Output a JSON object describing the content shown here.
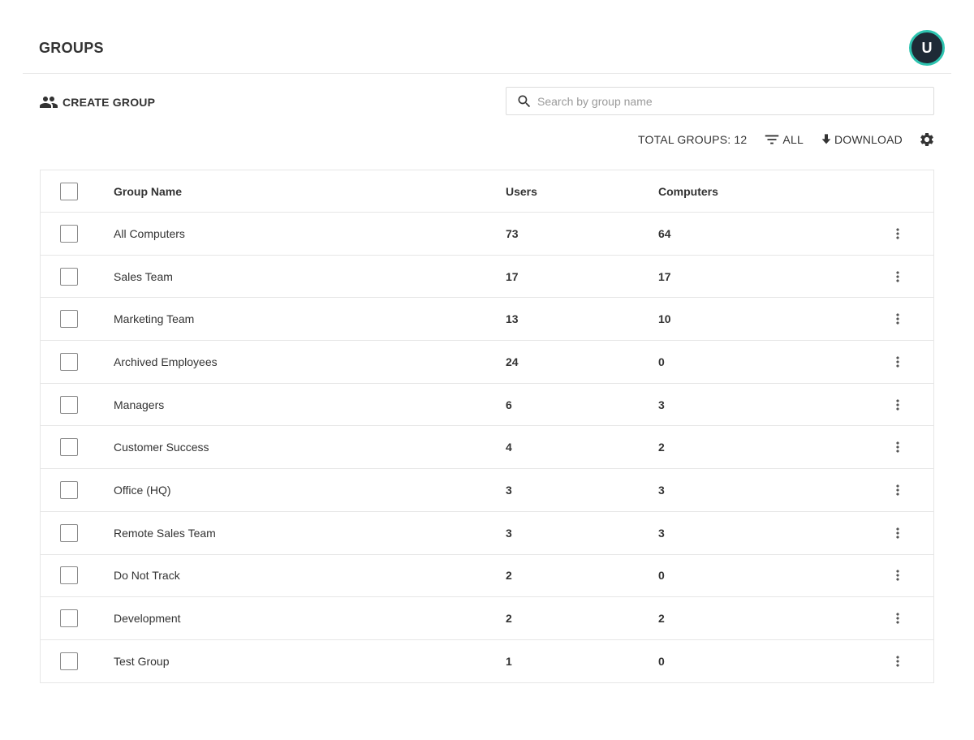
{
  "header": {
    "title": "GROUPS",
    "avatar_initial": "U"
  },
  "toolbar": {
    "create_group_label": "CREATE GROUP",
    "search_placeholder": "Search by group name",
    "search_value": "",
    "total_groups_label": "TOTAL GROUPS: 12",
    "filter_label": "ALL",
    "download_label": "DOWNLOAD"
  },
  "table": {
    "columns": {
      "name": "Group Name",
      "users": "Users",
      "computers": "Computers"
    },
    "rows": [
      {
        "name": "All Computers",
        "users": "73",
        "computers": "64"
      },
      {
        "name": "Sales Team",
        "users": "17",
        "computers": "17"
      },
      {
        "name": "Marketing Team",
        "users": "13",
        "computers": "10"
      },
      {
        "name": "Archived Employees",
        "users": "24",
        "computers": "0"
      },
      {
        "name": "Managers",
        "users": "6",
        "computers": "3"
      },
      {
        "name": "Customer Success",
        "users": "4",
        "computers": "2"
      },
      {
        "name": "Office (HQ)",
        "users": "3",
        "computers": "3"
      },
      {
        "name": "Remote Sales Team",
        "users": "3",
        "computers": "3"
      },
      {
        "name": "Do Not Track",
        "users": "2",
        "computers": "0"
      },
      {
        "name": "Development",
        "users": "2",
        "computers": "2"
      },
      {
        "name": "Test Group",
        "users": "1",
        "computers": "0"
      }
    ]
  },
  "icons": {
    "create_group": "people-icon",
    "search": "search-icon",
    "filter": "filter-icon",
    "download": "download-icon",
    "settings": "gear-icon",
    "row_menu": "more-vert-icon"
  },
  "colors": {
    "avatar_bg": "#1e2a36",
    "avatar_ring": "#2ec4b0",
    "text": "#333333"
  }
}
